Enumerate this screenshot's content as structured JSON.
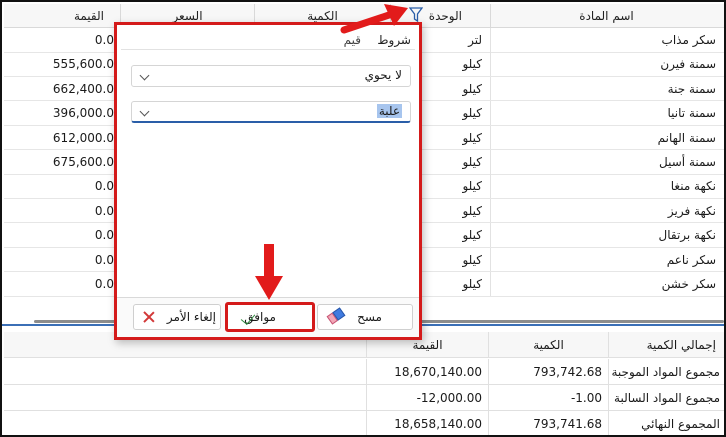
{
  "columns": {
    "item_name": "اسم المادة",
    "unit": "الوحدة",
    "quantity": "الكمية",
    "price": "السعر",
    "value": "القيمة"
  },
  "rows": [
    {
      "name": "سكر مذاب",
      "unit": "لتر",
      "value": "0.0"
    },
    {
      "name": "سمنة فيرن",
      "unit": "كيلو",
      "value": "555,600.0"
    },
    {
      "name": "سمنة جنة",
      "unit": "كيلو",
      "value": "662,400.0"
    },
    {
      "name": "سمنة تانيا",
      "unit": "كيلو",
      "value": "396,000.0"
    },
    {
      "name": "سمنة الهانم",
      "unit": "كيلو",
      "value": "612,000.0"
    },
    {
      "name": "سمنة أسيل",
      "unit": "كيلو",
      "value": "675,600.0"
    },
    {
      "name": "نكهة منغا",
      "unit": "كيلو",
      "value": "0.0"
    },
    {
      "name": "نكهة فريز",
      "unit": "كيلو",
      "value": "0.0"
    },
    {
      "name": "نكهة برتقال",
      "unit": "كيلو",
      "value": "0.0"
    },
    {
      "name": "سكر ناعم",
      "unit": "كيلو",
      "value": "0.0"
    },
    {
      "name": "سكر خشن",
      "unit": "كيلو",
      "value": "0.0"
    }
  ],
  "summary": {
    "headers": {
      "label": "إجمالي الكمية",
      "quantity": "الكمية",
      "value": "القيمة"
    },
    "rows": [
      {
        "label": "مجموع المواد الموجبة",
        "quantity": "793,742.68",
        "value": "18,670,140.00"
      },
      {
        "label": "مجموع المواد السالبة",
        "quantity": "-1.00",
        "value": "-12,000.00"
      },
      {
        "label": "المجموع النهائي",
        "quantity": "793,741.68",
        "value": "18,658,140.00"
      }
    ]
  },
  "filter_popup": {
    "tabs": {
      "conditions": "شروط",
      "values": "قيم"
    },
    "operator_value": "لا يحوي",
    "filter_text": "علبة",
    "buttons": {
      "clear": "مسح",
      "ok": "موافق",
      "cancel": "إلغاء الأمر"
    }
  },
  "colors": {
    "highlight_red": "#d41a1a",
    "accent_blue": "#2a5ea8"
  },
  "icons": [
    "filter-icon",
    "eraser-icon",
    "check-icon",
    "close-icon",
    "chevron-down-icon"
  ]
}
